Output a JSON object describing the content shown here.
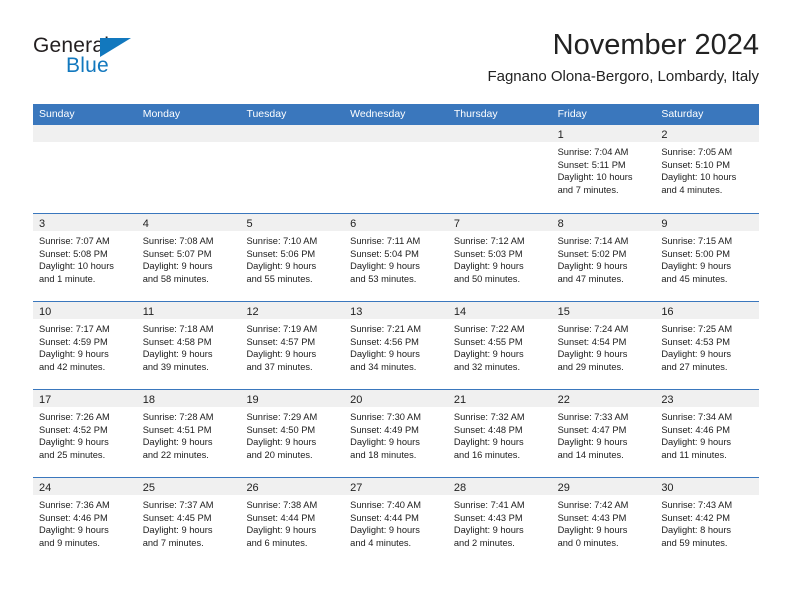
{
  "brand": {
    "name_top": "General",
    "name_bottom": "Blue",
    "color_dark": "#231f20",
    "color_blue": "#1278be"
  },
  "header": {
    "title": "November 2024",
    "subtitle": "Fagnano Olona-Bergoro, Lombardy, Italy"
  },
  "theme": {
    "header_blue": "#3a77bd",
    "day_strip_gray": "#f0f0f0",
    "text": "#1c1c1c"
  },
  "weekdays": [
    "Sunday",
    "Monday",
    "Tuesday",
    "Wednesday",
    "Thursday",
    "Friday",
    "Saturday"
  ],
  "weeks": [
    [
      {
        "day": "",
        "sunrise": "",
        "sunset": "",
        "daylight1": "",
        "daylight2": ""
      },
      {
        "day": "",
        "sunrise": "",
        "sunset": "",
        "daylight1": "",
        "daylight2": ""
      },
      {
        "day": "",
        "sunrise": "",
        "sunset": "",
        "daylight1": "",
        "daylight2": ""
      },
      {
        "day": "",
        "sunrise": "",
        "sunset": "",
        "daylight1": "",
        "daylight2": ""
      },
      {
        "day": "",
        "sunrise": "",
        "sunset": "",
        "daylight1": "",
        "daylight2": ""
      },
      {
        "day": "1",
        "sunrise": "Sunrise: 7:04 AM",
        "sunset": "Sunset: 5:11 PM",
        "daylight1": "Daylight: 10 hours",
        "daylight2": "and 7 minutes."
      },
      {
        "day": "2",
        "sunrise": "Sunrise: 7:05 AM",
        "sunset": "Sunset: 5:10 PM",
        "daylight1": "Daylight: 10 hours",
        "daylight2": "and 4 minutes."
      }
    ],
    [
      {
        "day": "3",
        "sunrise": "Sunrise: 7:07 AM",
        "sunset": "Sunset: 5:08 PM",
        "daylight1": "Daylight: 10 hours",
        "daylight2": "and 1 minute."
      },
      {
        "day": "4",
        "sunrise": "Sunrise: 7:08 AM",
        "sunset": "Sunset: 5:07 PM",
        "daylight1": "Daylight: 9 hours",
        "daylight2": "and 58 minutes."
      },
      {
        "day": "5",
        "sunrise": "Sunrise: 7:10 AM",
        "sunset": "Sunset: 5:06 PM",
        "daylight1": "Daylight: 9 hours",
        "daylight2": "and 55 minutes."
      },
      {
        "day": "6",
        "sunrise": "Sunrise: 7:11 AM",
        "sunset": "Sunset: 5:04 PM",
        "daylight1": "Daylight: 9 hours",
        "daylight2": "and 53 minutes."
      },
      {
        "day": "7",
        "sunrise": "Sunrise: 7:12 AM",
        "sunset": "Sunset: 5:03 PM",
        "daylight1": "Daylight: 9 hours",
        "daylight2": "and 50 minutes."
      },
      {
        "day": "8",
        "sunrise": "Sunrise: 7:14 AM",
        "sunset": "Sunset: 5:02 PM",
        "daylight1": "Daylight: 9 hours",
        "daylight2": "and 47 minutes."
      },
      {
        "day": "9",
        "sunrise": "Sunrise: 7:15 AM",
        "sunset": "Sunset: 5:00 PM",
        "daylight1": "Daylight: 9 hours",
        "daylight2": "and 45 minutes."
      }
    ],
    [
      {
        "day": "10",
        "sunrise": "Sunrise: 7:17 AM",
        "sunset": "Sunset: 4:59 PM",
        "daylight1": "Daylight: 9 hours",
        "daylight2": "and 42 minutes."
      },
      {
        "day": "11",
        "sunrise": "Sunrise: 7:18 AM",
        "sunset": "Sunset: 4:58 PM",
        "daylight1": "Daylight: 9 hours",
        "daylight2": "and 39 minutes."
      },
      {
        "day": "12",
        "sunrise": "Sunrise: 7:19 AM",
        "sunset": "Sunset: 4:57 PM",
        "daylight1": "Daylight: 9 hours",
        "daylight2": "and 37 minutes."
      },
      {
        "day": "13",
        "sunrise": "Sunrise: 7:21 AM",
        "sunset": "Sunset: 4:56 PM",
        "daylight1": "Daylight: 9 hours",
        "daylight2": "and 34 minutes."
      },
      {
        "day": "14",
        "sunrise": "Sunrise: 7:22 AM",
        "sunset": "Sunset: 4:55 PM",
        "daylight1": "Daylight: 9 hours",
        "daylight2": "and 32 minutes."
      },
      {
        "day": "15",
        "sunrise": "Sunrise: 7:24 AM",
        "sunset": "Sunset: 4:54 PM",
        "daylight1": "Daylight: 9 hours",
        "daylight2": "and 29 minutes."
      },
      {
        "day": "16",
        "sunrise": "Sunrise: 7:25 AM",
        "sunset": "Sunset: 4:53 PM",
        "daylight1": "Daylight: 9 hours",
        "daylight2": "and 27 minutes."
      }
    ],
    [
      {
        "day": "17",
        "sunrise": "Sunrise: 7:26 AM",
        "sunset": "Sunset: 4:52 PM",
        "daylight1": "Daylight: 9 hours",
        "daylight2": "and 25 minutes."
      },
      {
        "day": "18",
        "sunrise": "Sunrise: 7:28 AM",
        "sunset": "Sunset: 4:51 PM",
        "daylight1": "Daylight: 9 hours",
        "daylight2": "and 22 minutes."
      },
      {
        "day": "19",
        "sunrise": "Sunrise: 7:29 AM",
        "sunset": "Sunset: 4:50 PM",
        "daylight1": "Daylight: 9 hours",
        "daylight2": "and 20 minutes."
      },
      {
        "day": "20",
        "sunrise": "Sunrise: 7:30 AM",
        "sunset": "Sunset: 4:49 PM",
        "daylight1": "Daylight: 9 hours",
        "daylight2": "and 18 minutes."
      },
      {
        "day": "21",
        "sunrise": "Sunrise: 7:32 AM",
        "sunset": "Sunset: 4:48 PM",
        "daylight1": "Daylight: 9 hours",
        "daylight2": "and 16 minutes."
      },
      {
        "day": "22",
        "sunrise": "Sunrise: 7:33 AM",
        "sunset": "Sunset: 4:47 PM",
        "daylight1": "Daylight: 9 hours",
        "daylight2": "and 14 minutes."
      },
      {
        "day": "23",
        "sunrise": "Sunrise: 7:34 AM",
        "sunset": "Sunset: 4:46 PM",
        "daylight1": "Daylight: 9 hours",
        "daylight2": "and 11 minutes."
      }
    ],
    [
      {
        "day": "24",
        "sunrise": "Sunrise: 7:36 AM",
        "sunset": "Sunset: 4:46 PM",
        "daylight1": "Daylight: 9 hours",
        "daylight2": "and 9 minutes."
      },
      {
        "day": "25",
        "sunrise": "Sunrise: 7:37 AM",
        "sunset": "Sunset: 4:45 PM",
        "daylight1": "Daylight: 9 hours",
        "daylight2": "and 7 minutes."
      },
      {
        "day": "26",
        "sunrise": "Sunrise: 7:38 AM",
        "sunset": "Sunset: 4:44 PM",
        "daylight1": "Daylight: 9 hours",
        "daylight2": "and 6 minutes."
      },
      {
        "day": "27",
        "sunrise": "Sunrise: 7:40 AM",
        "sunset": "Sunset: 4:44 PM",
        "daylight1": "Daylight: 9 hours",
        "daylight2": "and 4 minutes."
      },
      {
        "day": "28",
        "sunrise": "Sunrise: 7:41 AM",
        "sunset": "Sunset: 4:43 PM",
        "daylight1": "Daylight: 9 hours",
        "daylight2": "and 2 minutes."
      },
      {
        "day": "29",
        "sunrise": "Sunrise: 7:42 AM",
        "sunset": "Sunset: 4:43 PM",
        "daylight1": "Daylight: 9 hours",
        "daylight2": "and 0 minutes."
      },
      {
        "day": "30",
        "sunrise": "Sunrise: 7:43 AM",
        "sunset": "Sunset: 4:42 PM",
        "daylight1": "Daylight: 8 hours",
        "daylight2": "and 59 minutes."
      }
    ]
  ]
}
